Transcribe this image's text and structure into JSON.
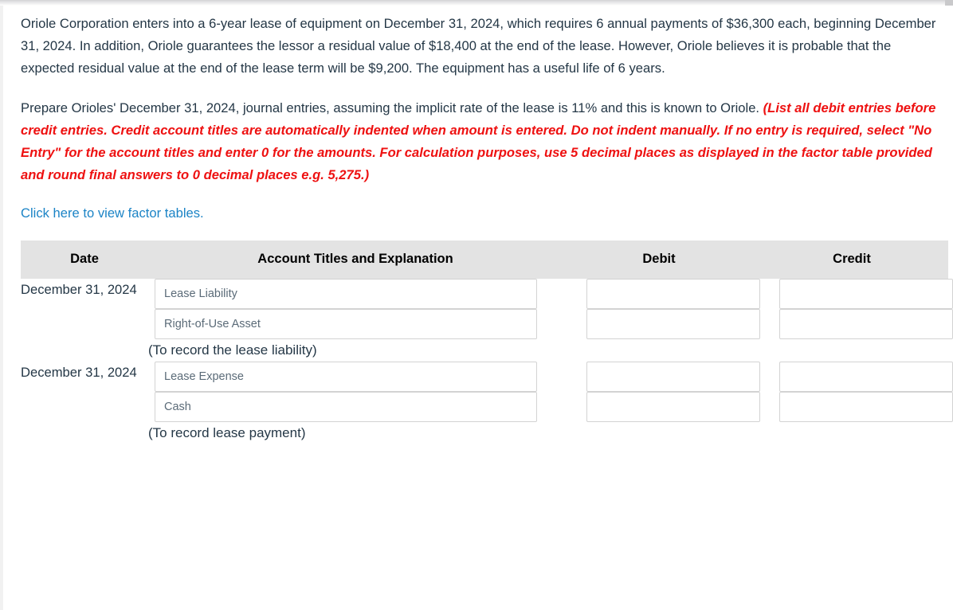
{
  "problem": {
    "paragraph1": "Oriole Corporation enters into a 6-year lease of equipment on December 31, 2024, which requires 6 annual payments of $36,300 each, beginning December 31, 2024. In addition, Oriole guarantees the lessor a residual value of $18,400 at the end of the lease. However, Oriole believes it is probable that the expected residual value at the end of the lease term will be $9,200. The equipment has a useful life of 6 years.",
    "paragraph2_lead": "Prepare Orioles' December 31, 2024, journal entries, assuming the implicit rate of the lease is 11% and this is known to Oriole. ",
    "paragraph2_instruction": "(List all debit entries before credit entries. Credit account titles are automatically indented when amount is entered. Do not indent manually. If no entry is required, select \"No Entry\" for the account titles and enter 0 for the amounts. For calculation purposes, use 5 decimal places as displayed in the factor table provided and round final answers to 0 decimal places e.g. 5,275.)",
    "factor_link": "Click here to view factor tables."
  },
  "colors": {
    "instruction_red": "#ee1111",
    "link_blue": "#1c84c6",
    "header_band": "#e3e3e3",
    "body_text": "#243746",
    "input_border": "#d3d3d3",
    "input_text": "#5b6b78"
  },
  "journal": {
    "headers": {
      "date": "Date",
      "account": "Account Titles and Explanation",
      "debit": "Debit",
      "credit": "Credit"
    },
    "placeholders": {
      "account": "",
      "amount": ""
    },
    "entries": [
      {
        "date": "December 31, 2024",
        "lines": [
          {
            "account": "Lease Liability",
            "debit": "",
            "credit": ""
          },
          {
            "account": "Right-of-Use Asset",
            "debit": "",
            "credit": ""
          }
        ],
        "memo": "(To record the lease liability)"
      },
      {
        "date": "December 31, 2024",
        "lines": [
          {
            "account": "Lease Expense",
            "debit": "",
            "credit": ""
          },
          {
            "account": "Cash",
            "debit": "",
            "credit": ""
          }
        ],
        "memo": "(To record lease payment)"
      }
    ]
  }
}
